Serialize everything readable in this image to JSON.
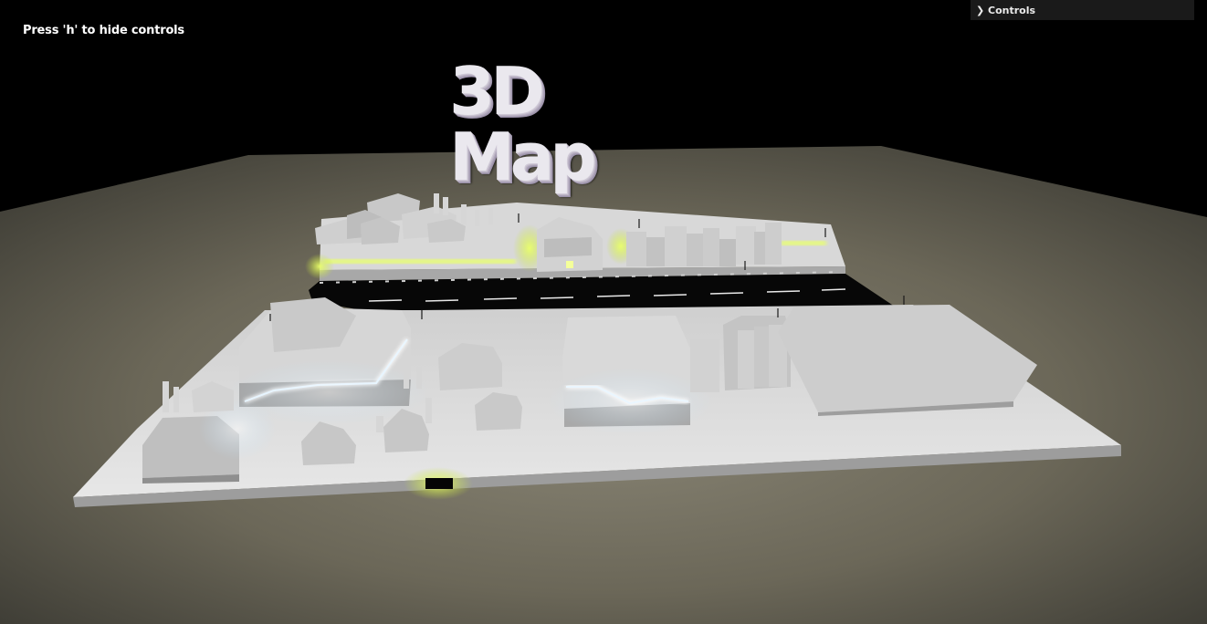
{
  "overlay": {
    "hint_text": "Press 'h' to hide controls"
  },
  "gui": {
    "controls_label": "Controls",
    "chevron_icon": "chevron-right-icon"
  },
  "scene": {
    "title_text": "3D Map",
    "colors": {
      "background": "#000000",
      "ground": "#6f6b5f",
      "platform": "#d9d9d9",
      "buildings": "#cfcfcf",
      "road": "#050505",
      "glow_yellow": "#d9ff4a",
      "glow_white": "#eaf6ff"
    }
  }
}
